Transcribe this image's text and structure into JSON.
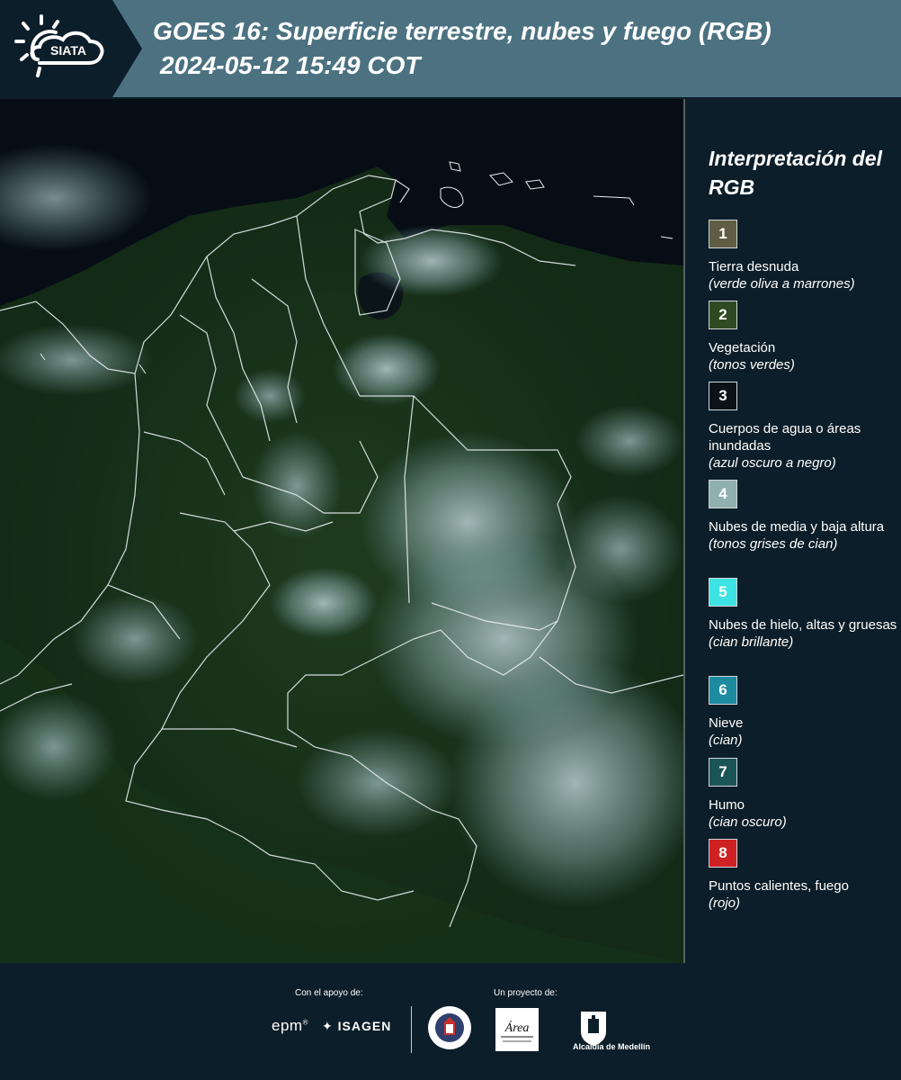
{
  "header": {
    "logo_text": "SIATA",
    "title_line1": "GOES 16: Superficie terrestre, nubes y fuego (RGB)",
    "title_line2": "2024-05-12 15:49 COT"
  },
  "legend": {
    "title": "Interpretación del RGB",
    "items": [
      {
        "number": "1",
        "label": "Tierra desnuda",
        "sub": "(verde oliva a marrones)",
        "color": "#5f5e45"
      },
      {
        "number": "2",
        "label": "Vegetación",
        "sub": "(tonos verdes)",
        "color": "#2f4a22"
      },
      {
        "number": "3",
        "label": "Cuerpos de agua o áreas inundadas",
        "sub": "(azul oscuro a negro)",
        "color": "#0b1319"
      },
      {
        "number": "4",
        "label": "Nubes de media y baja altura",
        "sub": "(tonos grises de cian)",
        "color": "#8fb0ae"
      },
      {
        "number": "5",
        "label": "Nubes de hielo, altas y gruesas",
        "sub": "(cian brillante)",
        "color": "#3de3e3"
      },
      {
        "number": "6",
        "label": "Nieve",
        "sub": "(cian)",
        "color": "#1c8ba0"
      },
      {
        "number": "7",
        "label": "Humo",
        "sub": "(cian oscuro)",
        "color": "#1c5558"
      },
      {
        "number": "8",
        "label": "Puntos calientes, fuego",
        "sub": "(rojo)",
        "color": "#cf2123"
      }
    ]
  },
  "footer": {
    "support_label": "Con el apoyo de:",
    "project_label": "Un proyecto de:",
    "epm": "epm",
    "isagen": "ISAGEN",
    "area_metropolitana": "Área",
    "alcaldia": "Alcaldía de Medellín"
  }
}
